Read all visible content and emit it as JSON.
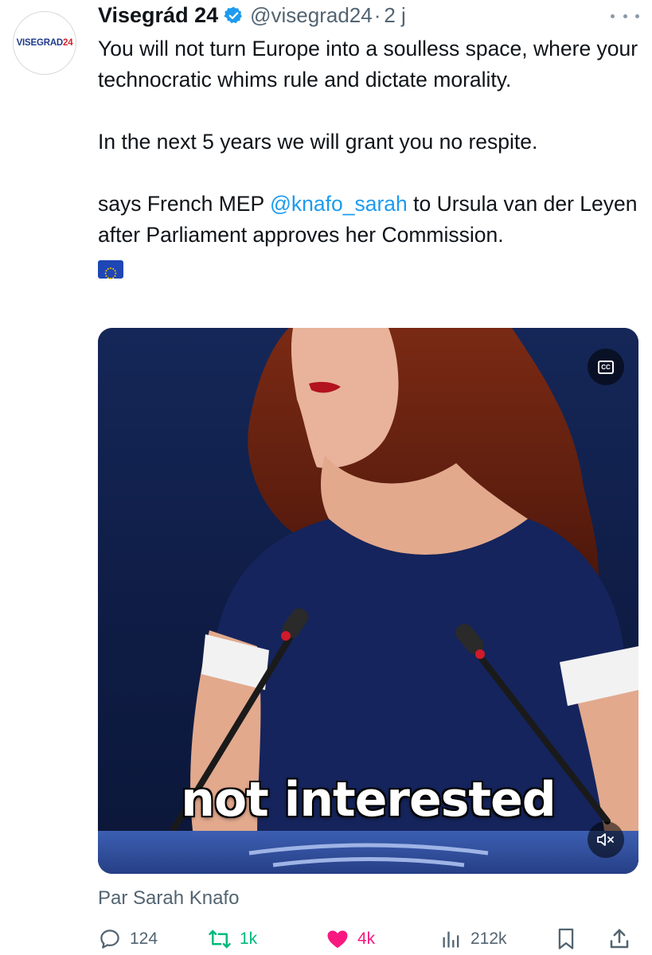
{
  "account": {
    "display_name": "Visegrád 24",
    "handle": "@visegrad24",
    "separator": "·",
    "time": "2 j",
    "avatar_text_main": "VISEGRAD",
    "avatar_text_accent": "24"
  },
  "tweet": {
    "paragraph1": "You will not turn Europe into a soulless space, where your technocratic whims rule and dictate morality.",
    "paragraph2": "In the next 5 years we will grant you no respite.",
    "paragraph3_before": "says French MEP ",
    "mention": "@knafo_sarah",
    "paragraph3_after": " to Ursula van der Leyen after Parliament approves her Commission.",
    "flag_icon": "eu-flag-emoji"
  },
  "media": {
    "caption": "not interested",
    "cc_label": "CC",
    "attribution": "Par Sarah Knafo"
  },
  "actions": {
    "replies": "124",
    "reposts": "1k",
    "likes": "4k",
    "views": "212k"
  },
  "colors": {
    "accent": "#1d9bf0",
    "repost": "#00ba7c",
    "like": "#f91880",
    "muted": "#536471"
  }
}
